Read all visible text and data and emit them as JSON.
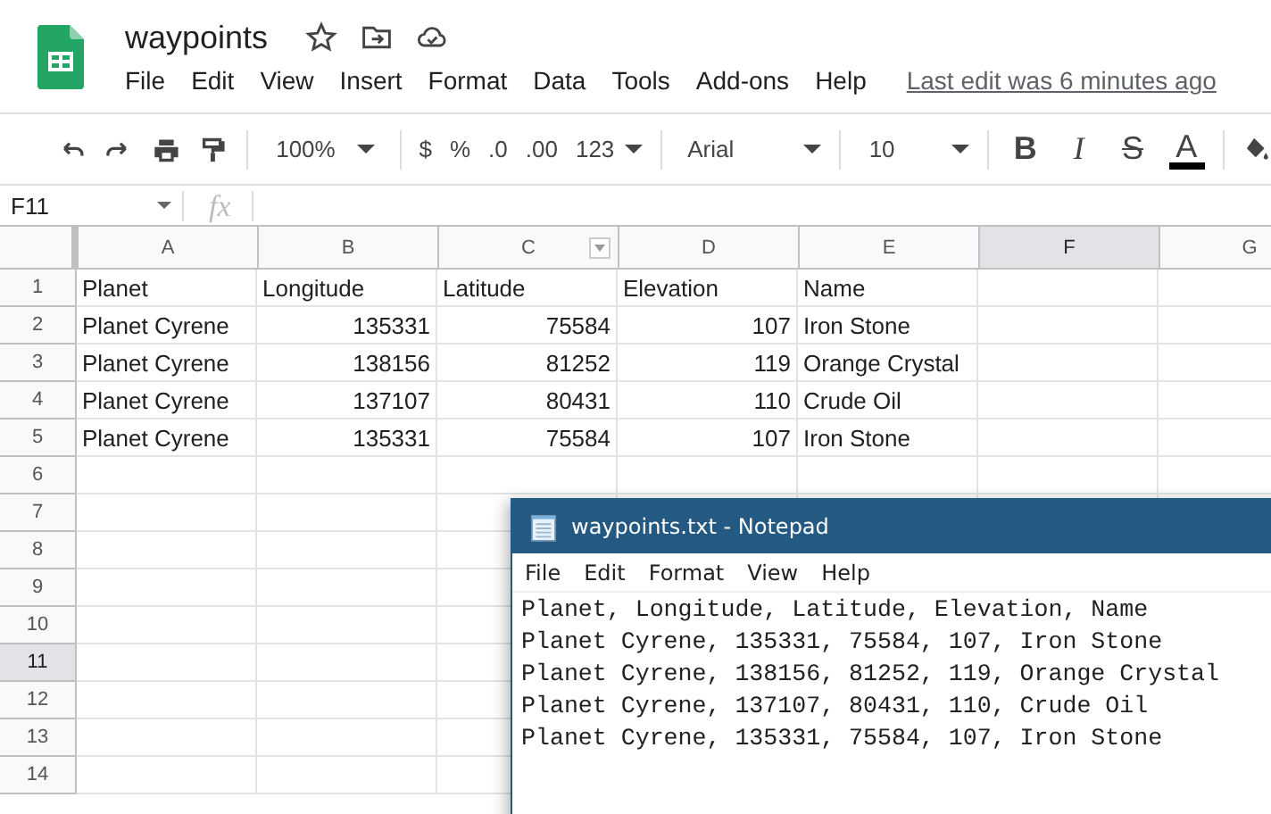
{
  "app": {
    "title": "waypoints",
    "menu": [
      "File",
      "Edit",
      "View",
      "Insert",
      "Format",
      "Data",
      "Tools",
      "Add-ons",
      "Help"
    ],
    "last_edit": "Last edit was 6 minutes ago"
  },
  "toolbar": {
    "zoom": "100%",
    "currency": "$",
    "percent": "%",
    "decrease_decimals": ".0",
    "increase_decimals": ".00",
    "number_format": "123",
    "font": "Arial",
    "font_size": "10",
    "bold": "B",
    "italic": "I",
    "strikethrough": "S",
    "text_color": "A"
  },
  "formula_bar": {
    "cell_ref": "F11",
    "fx": "fx"
  },
  "sheet": {
    "columns": [
      {
        "label": "A",
        "selected": false,
        "filter": false
      },
      {
        "label": "B",
        "selected": false,
        "filter": false
      },
      {
        "label": "C",
        "selected": false,
        "filter": true
      },
      {
        "label": "D",
        "selected": false,
        "filter": false
      },
      {
        "label": "E",
        "selected": false,
        "filter": false
      },
      {
        "label": "F",
        "selected": true,
        "filter": false
      },
      {
        "label": "G",
        "selected": false
      }
    ],
    "rows": [
      {
        "label": "1",
        "selected": false,
        "cells": [
          {
            "value": "Planet",
            "kind": "text"
          },
          {
            "value": "Longitude",
            "kind": "text"
          },
          {
            "value": "Latitude",
            "kind": "text"
          },
          {
            "value": "Elevation",
            "kind": "text"
          },
          {
            "value": "Name",
            "kind": "text"
          }
        ]
      },
      {
        "label": "2",
        "selected": false,
        "cells": [
          {
            "value": "Planet Cyrene",
            "kind": "text"
          },
          {
            "value": "135331",
            "kind": "number"
          },
          {
            "value": "75584",
            "kind": "number"
          },
          {
            "value": "107",
            "kind": "number"
          },
          {
            "value": "Iron Stone",
            "kind": "text"
          }
        ]
      },
      {
        "label": "3",
        "selected": false,
        "cells": [
          {
            "value": "Planet Cyrene",
            "kind": "text"
          },
          {
            "value": "138156",
            "kind": "number"
          },
          {
            "value": "81252",
            "kind": "number"
          },
          {
            "value": "119",
            "kind": "number"
          },
          {
            "value": "Orange Crystal",
            "kind": "text"
          }
        ]
      },
      {
        "label": "4",
        "selected": false,
        "cells": [
          {
            "value": "Planet Cyrene",
            "kind": "text"
          },
          {
            "value": "137107",
            "kind": "number"
          },
          {
            "value": "80431",
            "kind": "number"
          },
          {
            "value": "110",
            "kind": "number"
          },
          {
            "value": "Crude Oil",
            "kind": "text"
          }
        ]
      },
      {
        "label": "5",
        "selected": false,
        "cells": [
          {
            "value": "Planet Cyrene",
            "kind": "text"
          },
          {
            "value": "135331",
            "kind": "number"
          },
          {
            "value": "75584",
            "kind": "number"
          },
          {
            "value": "107",
            "kind": "number"
          },
          {
            "value": "Iron Stone",
            "kind": "text"
          }
        ]
      },
      {
        "label": "6",
        "selected": false
      },
      {
        "label": "7",
        "selected": false
      },
      {
        "label": "8",
        "selected": false
      },
      {
        "label": "9",
        "selected": false
      },
      {
        "label": "10",
        "selected": false
      },
      {
        "label": "11",
        "selected": true
      },
      {
        "label": "12",
        "selected": false
      },
      {
        "label": "13",
        "selected": false
      },
      {
        "label": "14",
        "selected": false
      }
    ]
  },
  "notepad": {
    "title": "waypoints.txt - Notepad",
    "menu": [
      "File",
      "Edit",
      "Format",
      "View",
      "Help"
    ],
    "lines": [
      "Planet, Longitude, Latitude, Elevation, Name",
      "Planet Cyrene, 135331, 75584, 107, Iron Stone",
      "Planet Cyrene, 138156, 81252, 119, Orange Crystal",
      "Planet Cyrene, 137107, 80431, 110, Crude Oil",
      "Planet Cyrene, 135331, 75584, 107, Iron Stone"
    ]
  }
}
